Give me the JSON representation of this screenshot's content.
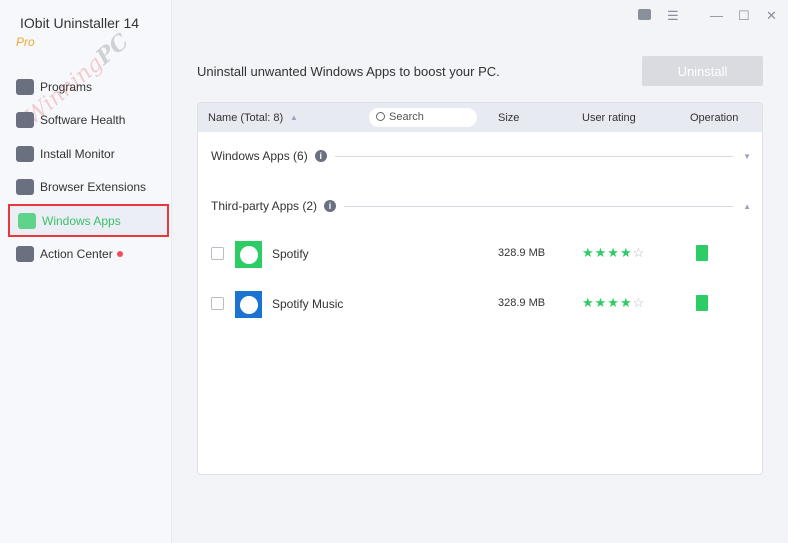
{
  "app": {
    "title": "IObit Uninstaller 14",
    "edition": "Pro",
    "watermark": "WinningPC"
  },
  "sidebar": {
    "items": [
      {
        "label": "Programs"
      },
      {
        "label": "Software Health"
      },
      {
        "label": "Install Monitor"
      },
      {
        "label": "Browser Extensions"
      },
      {
        "label": "Windows Apps"
      },
      {
        "label": "Action Center"
      }
    ]
  },
  "window_controls": {
    "toolbox": "toolbox-icon",
    "menu": "☰",
    "minimize": "—",
    "maximize": "☐",
    "close": "✕"
  },
  "main": {
    "heading": "Uninstall unwanted Windows Apps to boost your PC.",
    "uninstall_label": "Uninstall",
    "table": {
      "name_header": "Name (Total: 8)",
      "search_placeholder": "Search",
      "size_header": "Size",
      "rating_header": "User rating",
      "operation_header": "Operation"
    },
    "groups": [
      {
        "label": "Windows Apps (6)",
        "expanded": false
      },
      {
        "label": "Third-party Apps (2)",
        "expanded": true
      }
    ],
    "apps": [
      {
        "name": "Spotify",
        "size": "328.9 MB",
        "rating": 4,
        "icon_color": "#2ecc64"
      },
      {
        "name": "Spotify Music",
        "size": "328.9 MB",
        "rating": 4,
        "icon_color": "#1a73d0"
      }
    ]
  },
  "colors": {
    "accent": "#2ecc64",
    "highlight": "#e8383d"
  }
}
